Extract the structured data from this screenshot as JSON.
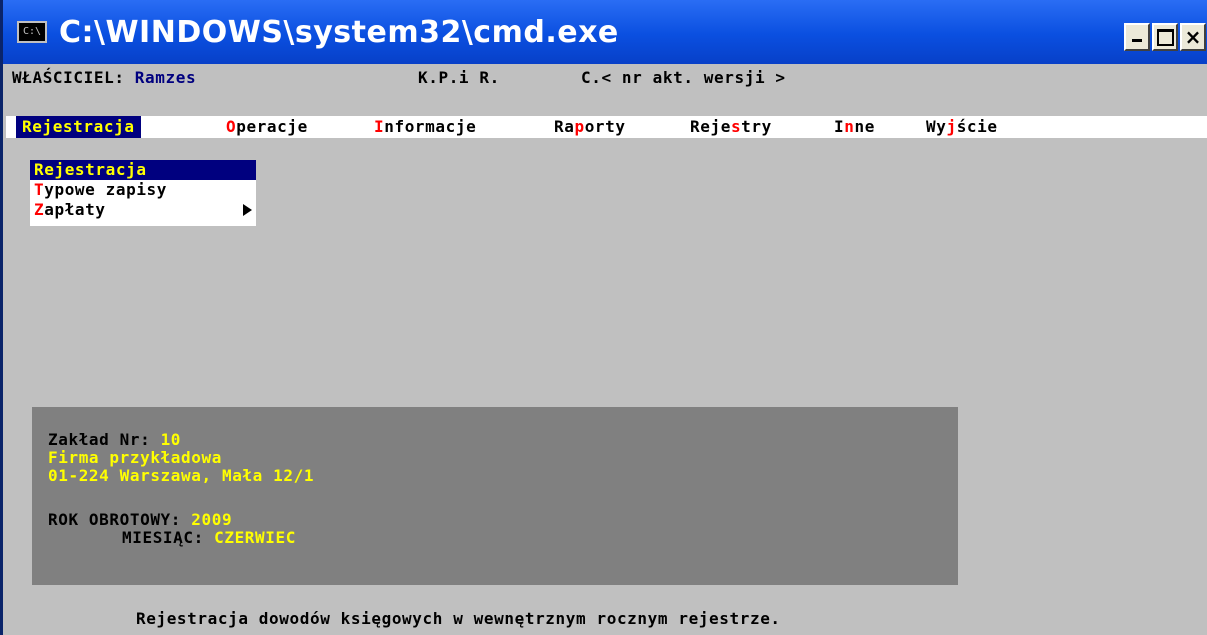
{
  "window": {
    "title": "C:\\WINDOWS\\system32\\cmd.exe",
    "icon": "console-app-icon",
    "icon_glyph": "C:\\",
    "buttons": [
      "minimize",
      "maximize",
      "close"
    ],
    "close_glyph": "×"
  },
  "header": {
    "owner_label": "WŁAŚCICIEL: ",
    "owner_value": "Ramzes",
    "app_name": "K.P.i R.",
    "version": "C.< nr akt. wersji >"
  },
  "menu": {
    "items": [
      {
        "hot": "R",
        "rest": "ejestracja"
      },
      {
        "hot": "O",
        "rest": "peracje"
      },
      {
        "hot": "I",
        "rest": "nformacje"
      },
      {
        "pre": "Ra",
        "hot": "p",
        "rest": "orty"
      },
      {
        "pre": "Reje",
        "hot": "s",
        "rest": "try"
      },
      {
        "pre": "I",
        "hot": "n",
        "rest": "ne"
      },
      {
        "pre": "Wy",
        "hot": "j",
        "rest": "ście"
      }
    ]
  },
  "dropdown": {
    "items": [
      {
        "hot": "R",
        "rest": "ejestracja"
      },
      {
        "hot": "T",
        "rest": "ypowe zapisy"
      },
      {
        "hot": "Z",
        "rest": "apłaty"
      }
    ]
  },
  "info": {
    "zaklad_label": "Zakład Nr: ",
    "zaklad_value": "10",
    "firm_name": "Firma przykładowa",
    "firm_address": "01-224 Warszawa, Mała 12/1",
    "year_label": "ROK OBROTOWY: ",
    "year_value": "2009",
    "month_label": "MIESIĄC: ",
    "month_value": "CZERWIEC"
  },
  "status": {
    "text": "Rejestracja dowodów księgowych w wewnętrznym rocznym rejestrze."
  },
  "colors": {
    "background": "#c0c0c0",
    "titlebar": "#0a4fe0",
    "highlight_bg": "#00007f",
    "highlight_fg": "#ffff00",
    "hotkey": "#ff0000",
    "panel": "#808080"
  }
}
